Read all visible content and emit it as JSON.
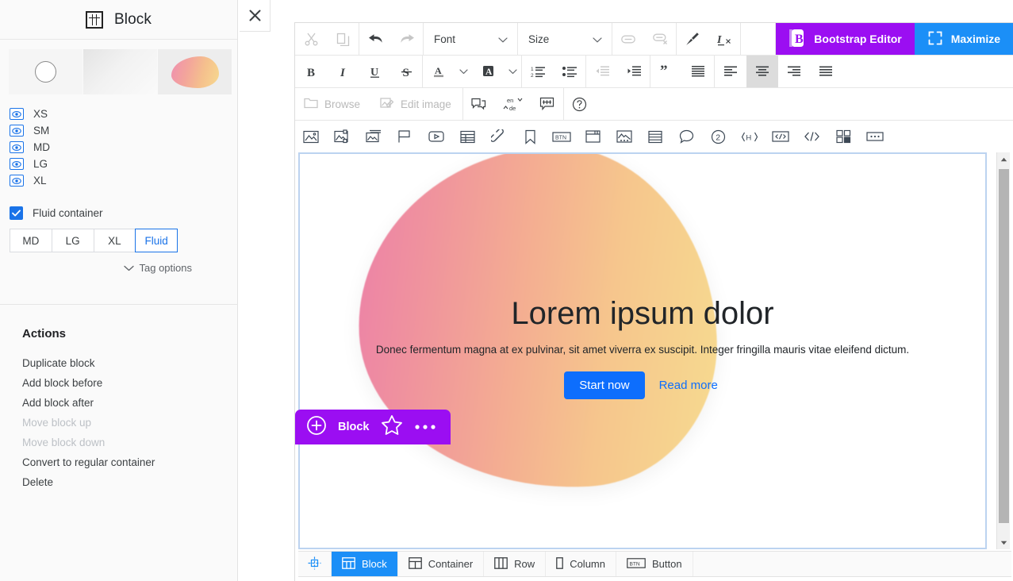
{
  "sidebar": {
    "title": "Block",
    "title_icon": "block-grid-icon",
    "close_icon": "close-icon",
    "thumbnails": [
      {
        "name": "thumb-plain-circle",
        "kind": "circle"
      },
      {
        "name": "thumb-gradient",
        "kind": "gradient"
      },
      {
        "name": "thumb-blob",
        "kind": "blob"
      }
    ],
    "visibility": [
      {
        "label": "XS",
        "icon": "eye-icon",
        "visible": true
      },
      {
        "label": "SM",
        "icon": "eye-icon",
        "visible": true
      },
      {
        "label": "MD",
        "icon": "eye-icon",
        "visible": true
      },
      {
        "label": "LG",
        "icon": "eye-icon",
        "visible": true
      },
      {
        "label": "XL",
        "icon": "eye-icon",
        "visible": true
      }
    ],
    "fluid_container": {
      "label": "Fluid container",
      "checked": true
    },
    "sizes": [
      {
        "label": "MD",
        "active": false
      },
      {
        "label": "LG",
        "active": false
      },
      {
        "label": "XL",
        "active": false
      },
      {
        "label": "Fluid",
        "active": true
      }
    ],
    "tag_options": {
      "label": "Tag options",
      "icon": "chevron-down-icon"
    },
    "actions_title": "Actions",
    "actions": [
      {
        "label": "Duplicate block",
        "disabled": false
      },
      {
        "label": "Add block before",
        "disabled": false
      },
      {
        "label": "Add block after",
        "disabled": false
      },
      {
        "label": "Move block up",
        "disabled": true
      },
      {
        "label": "Move block down",
        "disabled": true
      },
      {
        "label": "Convert to regular container",
        "disabled": false
      },
      {
        "label": "Delete",
        "disabled": false
      }
    ]
  },
  "toolbar": {
    "row1": {
      "cut_icon": "scissors-icon",
      "copy_icon": "copy-icon",
      "undo_icon": "undo-arrow-icon",
      "redo_icon": "redo-arrow-icon",
      "font_select": "Font",
      "size_select": "Size",
      "link_icon": "link-icon",
      "unlink_icon": "unlink-icon",
      "paintbrush_icon": "paintbrush-icon",
      "clear-format_icon": "clear-formatting-icon",
      "brand_label": "Bootstrap Editor",
      "brand_icon": "bootstrap-b-icon",
      "brand_color": "#9b0ef2",
      "maximize_label": "Maximize",
      "maximize_icon": "maximize-icon",
      "maximize_color": "#1b8ff7"
    },
    "row2": {
      "bold": "B",
      "italic": "I",
      "underline": "U",
      "strike": "S",
      "text_color_icon": "text-color-icon",
      "text_color_caret": "chevron-down-icon",
      "highlight_icon": "highlight-color-icon",
      "highlight_caret": "chevron-down-icon",
      "ordered_list_icon": "ordered-list-icon",
      "unordered_list_icon": "unordered-list-icon",
      "outdent_icon": "outdent-icon",
      "indent_icon": "indent-icon",
      "blockquote_icon": "blockquote-icon",
      "justify_full_icon": "align-justify-icon",
      "align_left_icon": "align-left-icon",
      "align_center_icon": "align-center-icon",
      "align_right_icon": "align-right-icon",
      "align_block_icon": "align-block-icon",
      "active_button": "align-center-icon"
    },
    "row3": {
      "browse_label": "Browse",
      "browse_icon": "folder-icon",
      "edit_image_label": "Edit image",
      "edit_image_icon": "edit-image-icon",
      "duplicate_icon": "duplicate-frame-icon",
      "translate_icon": "translate-en-de-icon",
      "translate_from": "en",
      "translate_to": "de",
      "adjust_icon": "adjust-sliders-icon",
      "help_icon": "help-circle-icon"
    },
    "row4_icons": [
      "image-icon",
      "image-gallery-icon",
      "image-stack-icon",
      "flag-icon",
      "video-icon",
      "table-icon",
      "link-chain-icon",
      "bookmark-icon",
      "button-icon",
      "window-icon",
      "image-card-icon",
      "list-block-icon",
      "comment-icon",
      "circle-two-icon",
      "heading-tag-icon",
      "code-block-icon",
      "inline-code-icon",
      "grid-blocks-icon",
      "more-ellipsis-icon"
    ]
  },
  "canvas": {
    "hero_title": "Lorem ipsum dolor",
    "hero_subtitle": "Donec fermentum magna at ex pulvinar, sit amet viverra ex suscipit. Integer fringilla mauris vitae eleifend dictum.",
    "cta_primary": "Start now",
    "cta_secondary": "Read more",
    "primary_color": "#0d6efd",
    "blob_from": "#ec7fa9",
    "blob_to": "#f7dc90",
    "selection_border": "#bcd3f0"
  },
  "block_badge": {
    "label": "Block",
    "add_icon": "plus-circle-icon",
    "star_icon": "star-icon",
    "more_icon": "ellipsis-icon",
    "color": "#9b0ef2"
  },
  "statusbar": {
    "target_icon": "crosshair-icon",
    "items": [
      {
        "label": "Block",
        "icon": "block-grid-icon",
        "active": true
      },
      {
        "label": "Container",
        "icon": "container-icon",
        "active": false
      },
      {
        "label": "Row",
        "icon": "row-icon",
        "active": false
      },
      {
        "label": "Column",
        "icon": "column-icon",
        "active": false
      },
      {
        "label": "Button",
        "icon": "button-icon",
        "active": false
      }
    ]
  },
  "scrollbar": {
    "up_icon": "triangle-up-icon",
    "down_icon": "triangle-down-icon"
  }
}
